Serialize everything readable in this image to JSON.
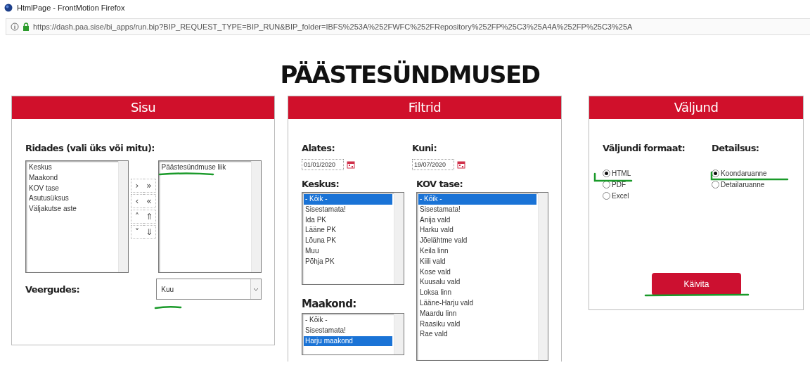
{
  "browser": {
    "title": "HtmlPage - FrontMotion Firefox",
    "url": "https://dash.paa.sise/bi_apps/run.bip?BIP_REQUEST_TYPE=BIP_RUN&BIP_folder=IBFS%253A%252FWFC%252FRepository%252FP%25C3%25A4A%252FP%25C3%25A"
  },
  "heading": "PÄÄSTESÜNDMUSED",
  "sisu": {
    "title": "Sisu",
    "rows_label": "Ridades (vali üks või mitu):",
    "available_items": [
      {
        "text": "Keskus",
        "selected": false
      },
      {
        "text": "Maakond",
        "selected": false
      },
      {
        "text": "KOV tase",
        "selected": false
      },
      {
        "text": "Asutusüksus",
        "selected": false
      },
      {
        "text": "Väljakutse aste",
        "selected": false
      }
    ],
    "move_buttons": [
      {
        "label": "›",
        "label_all": "»"
      },
      {
        "label": "‹",
        "label_all": "«"
      },
      {
        "label": "˄",
        "label_all": "⇑"
      },
      {
        "label": "˅",
        "label_all": "⇓"
      }
    ],
    "selected_items": [
      {
        "text": "Päästesündmuse liik",
        "selected": false
      }
    ],
    "columns_label": "Veergudes:",
    "columns_value": "Kuu"
  },
  "filtrid": {
    "title": "Filtrid",
    "dates": [
      {
        "label": "Alates:",
        "value": "01/01/2020"
      },
      {
        "label": "Kuni:",
        "value": "19/07/2020"
      }
    ],
    "keskus": {
      "label": "Keskus:",
      "items": [
        {
          "text": "- Kõik -",
          "selected": true
        },
        {
          "text": "Sisestamata!",
          "selected": false
        },
        {
          "text": "Ida PK",
          "selected": false
        },
        {
          "text": "Lääne PK",
          "selected": false
        },
        {
          "text": "Lõuna PK",
          "selected": false
        },
        {
          "text": "Muu",
          "selected": false
        },
        {
          "text": "Põhja PK",
          "selected": false
        }
      ]
    },
    "maakond": {
      "label": "Maakond:",
      "items": [
        {
          "text": "- Kõik -",
          "selected": false
        },
        {
          "text": "Sisestamata!",
          "selected": false
        },
        {
          "text": "Harju maakond",
          "selected": true
        }
      ]
    },
    "kov": {
      "label": "KOV tase:",
      "items": [
        {
          "text": "- Kõik -",
          "selected": true
        },
        {
          "text": "Sisestamata!",
          "selected": false
        },
        {
          "text": "Anija vald",
          "selected": false
        },
        {
          "text": "Harku vald",
          "selected": false
        },
        {
          "text": "Jõelähtme vald",
          "selected": false
        },
        {
          "text": "Keila linn",
          "selected": false
        },
        {
          "text": "Kiili vald",
          "selected": false
        },
        {
          "text": "Kose vald",
          "selected": false
        },
        {
          "text": "Kuusalu vald",
          "selected": false
        },
        {
          "text": "Loksa linn",
          "selected": false
        },
        {
          "text": "Lääne-Harju vald",
          "selected": false
        },
        {
          "text": "Maardu linn",
          "selected": false
        },
        {
          "text": "Raasiku vald",
          "selected": false
        },
        {
          "text": "Rae vald",
          "selected": false
        }
      ]
    }
  },
  "valjund": {
    "title": "Väljund",
    "groups": [
      {
        "label": "Väljundi formaat:",
        "options": [
          {
            "label": "HTML",
            "selected": true
          },
          {
            "label": "PDF",
            "selected": false
          },
          {
            "label": "Excel",
            "selected": false
          }
        ]
      },
      {
        "label": "Detailsus:",
        "options": [
          {
            "label": "Koondaruanne",
            "selected": true
          },
          {
            "label": "Detailaruanne",
            "selected": false
          }
        ]
      }
    ],
    "run_button": "Käivita"
  }
}
